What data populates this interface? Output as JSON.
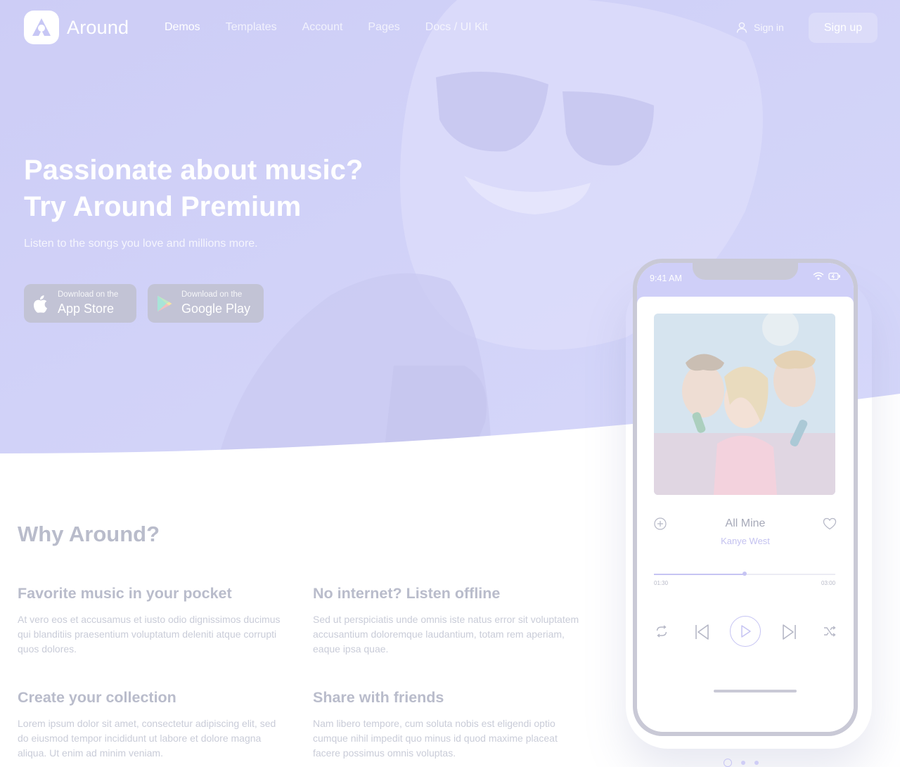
{
  "brand": {
    "name": "Around"
  },
  "nav": {
    "items": [
      {
        "label": "Demos",
        "active": true
      },
      {
        "label": "Templates",
        "active": false
      },
      {
        "label": "Account",
        "active": false
      },
      {
        "label": "Pages",
        "active": false
      },
      {
        "label": "Docs / UI Kit",
        "active": false
      }
    ],
    "signin_label": "Sign in",
    "signup_label": "Sign up"
  },
  "hero": {
    "title_line1": "Passionate about music?",
    "title_line2": "Try Around Premium",
    "subtitle": "Listen to the songs you love and millions more.",
    "app_store": {
      "small": "Download on the",
      "big": "App Store",
      "icon": "apple-icon"
    },
    "google_play": {
      "small": "Download on the",
      "big": "Google Play",
      "icon": "google-play-icon"
    }
  },
  "why": {
    "title": "Why Around?",
    "features": [
      {
        "title": "Favorite music in your pocket",
        "text": "At vero eos et accusamus et iusto odio dignissimos ducimus qui blanditiis praesentium voluptatum deleniti atque corrupti quos dolores."
      },
      {
        "title": "No internet? Listen offline",
        "text": "Sed ut perspiciatis unde omnis iste natus error sit voluptatem accusantium doloremque laudantium, totam rem aperiam, eaque ipsa quae."
      },
      {
        "title": "Create your collection",
        "text": "Lorem ipsum dolor sit amet, consectetur adipiscing elit, sed do eiusmod tempor incididunt ut labore et dolore magna aliqua. Ut enim ad minim veniam."
      },
      {
        "title": "Share with friends",
        "text": "Nam libero tempore, cum soluta nobis est eligendi optio cumque nihil impedit quo minus id quod maxime placeat facere possimus omnis voluptas."
      }
    ]
  },
  "player": {
    "status_time": "9:41 AM",
    "song_title": "All Mine",
    "artist": "Kanye West",
    "time_elapsed": "01:30",
    "time_total": "03:00",
    "progress": 0.5
  },
  "carousel": {
    "count": 3,
    "active_index": 0
  },
  "colors": {
    "accent": "#c6c4f3",
    "hero": "#d0d0f8",
    "text_muted": "#c9ccd8"
  }
}
